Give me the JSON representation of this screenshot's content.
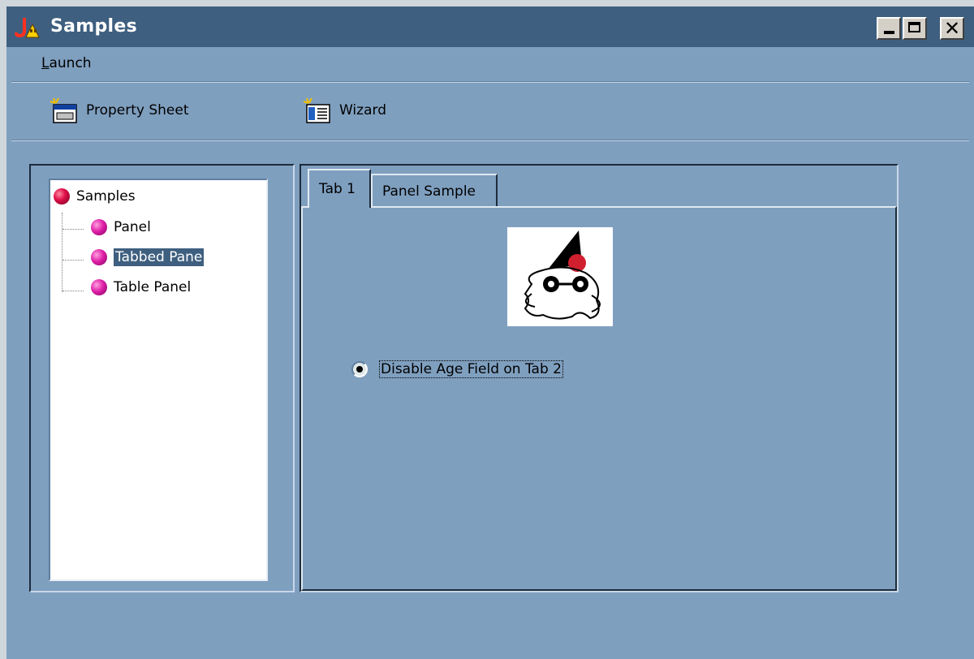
{
  "window": {
    "title": "Samples",
    "icon": "java-app-icon",
    "controls": [
      "minimize-icon",
      "maximize-icon",
      "close-icon"
    ],
    "close_glyph": "✕"
  },
  "menu": {
    "items": [
      {
        "label": "Launch",
        "mnemonic_prefix": "L",
        "rest": "aunch"
      }
    ]
  },
  "toolbar": {
    "items": [
      {
        "label": "Property Sheet",
        "icon": "property-sheet-icon"
      },
      {
        "label": "Wizard",
        "icon": "wizard-icon"
      }
    ]
  },
  "tree": {
    "root": {
      "label": "Samples",
      "icon": "tree-node-icon"
    },
    "children": [
      {
        "label": "Panel",
        "selected": false
      },
      {
        "label": "Tabbed Pane",
        "selected": true
      },
      {
        "label": "Table Panel",
        "selected": false
      }
    ]
  },
  "tabs": {
    "items": [
      {
        "label": "Tab 1",
        "active": true
      },
      {
        "label": "Panel Sample",
        "active": false
      }
    ],
    "content": {
      "image": "duke-mascot-icon",
      "radio": {
        "label": "Disable Age Field on Tab 2",
        "checked": true
      }
    }
  },
  "colors": {
    "background": "#7f9fbf",
    "titlebar": "#3e5f7f",
    "selection": "#3e5f7f"
  }
}
